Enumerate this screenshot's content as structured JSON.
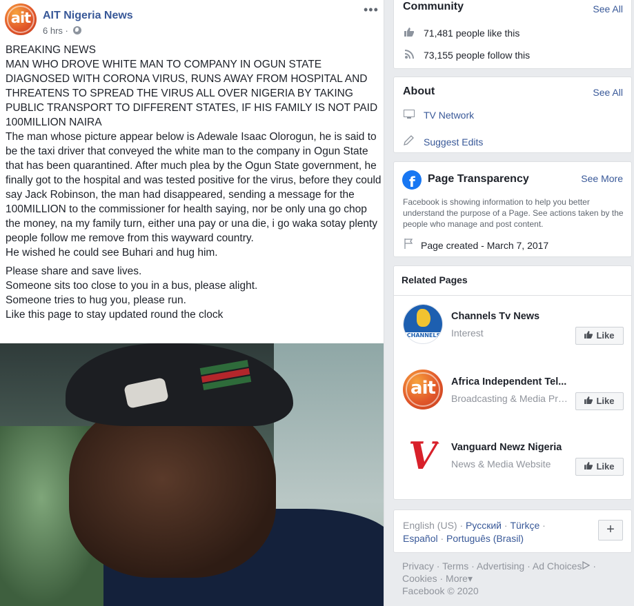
{
  "post": {
    "page_name": "AIT Nigeria News",
    "time": "6 hrs",
    "time_sep": "·",
    "logo_text": "ait",
    "more_icon": "more-horizontal-icon",
    "paragraphs": [
      "BREAKING NEWS",
      "MAN WHO DROVE WHITE MAN TO COMPANY IN OGUN STATE DIAGNOSED WITH CORONA VIRUS, RUNS AWAY FROM HOSPITAL AND THREATENS TO SPREAD THE VIRUS ALL OVER NIGERIA BY TAKING PUBLIC TRANSPORT TO DIFFERENT STATES, IF HIS FAMILY IS NOT PAID 100MILLION NAIRA",
      "The man whose picture appear below is Adewale Isaac Olorogun, he is said to be the taxi driver that conveyed the white man to the company in Ogun State that has been quarantined. After much plea by the Ogun State government, he finally got to the hospital and was tested positive for the virus, before they could say Jack Robinson, the man had disappeared, sending a message for the 100MILLION to the commissioner for health saying, nor be only una go chop the money, na my family turn, either una pay or una die, i go waka sotay plenty people follow me remove from this wayward country.",
      "He wished he could see Buhari and hug him."
    ],
    "paragraphs2": [
      "Please share and save lives.",
      "Someone sits too close to you in a bus, please alight.",
      "Someone tries to hug you, please run.",
      "Like this page to stay updated round the clock"
    ]
  },
  "community": {
    "title": "Community",
    "see_all": "See All",
    "likes": "71,481 people like this",
    "follows": "73,155 people follow this",
    "like_icon": "thumbs-up-icon",
    "follow_icon": "rss-icon"
  },
  "about": {
    "title": "About",
    "see_all": "See All",
    "category": "TV Network",
    "suggest": "Suggest Edits",
    "category_icon": "tv-icon",
    "suggest_icon": "pencil-icon"
  },
  "transparency": {
    "title": "Page Transparency",
    "see_more": "See More",
    "description": "Facebook is showing information to help you better understand the purpose of a Page. See actions taken by the people who manage and post content.",
    "created": "Page created - March 7, 2017",
    "fb_icon": "facebook-icon",
    "flag_icon": "flag-icon"
  },
  "related": {
    "title": "Related Pages",
    "like_label": "Like",
    "items": [
      {
        "name": "Channels Tv News",
        "category": "Interest",
        "logo_text": "CHANNELS"
      },
      {
        "name": "Africa Independent Tel...",
        "category": "Broadcasting & Media Pro...",
        "logo_text": "ait"
      },
      {
        "name": "Vanguard Newz Nigeria",
        "category": "News & Media Website",
        "logo_text": "V"
      }
    ]
  },
  "languages": {
    "current": "English (US)",
    "others": [
      "Русский",
      "Türkçe",
      "Español",
      "Português (Brasil)"
    ],
    "sep": "·",
    "plus": "+"
  },
  "footer": {
    "links": [
      "Privacy",
      "Terms",
      "Advertising",
      "Ad Choices",
      "Cookies",
      "More"
    ],
    "copyright": "Facebook © 2020",
    "sep": "·",
    "more_caret": "▾",
    "adchoices_icon": "ad-choices-icon"
  },
  "colors": {
    "link": "#385898",
    "background": "#e9ebee",
    "facebook_blue": "#1877f2",
    "ait_orange": "#e1572a",
    "vanguard_red": "#d8202a"
  }
}
